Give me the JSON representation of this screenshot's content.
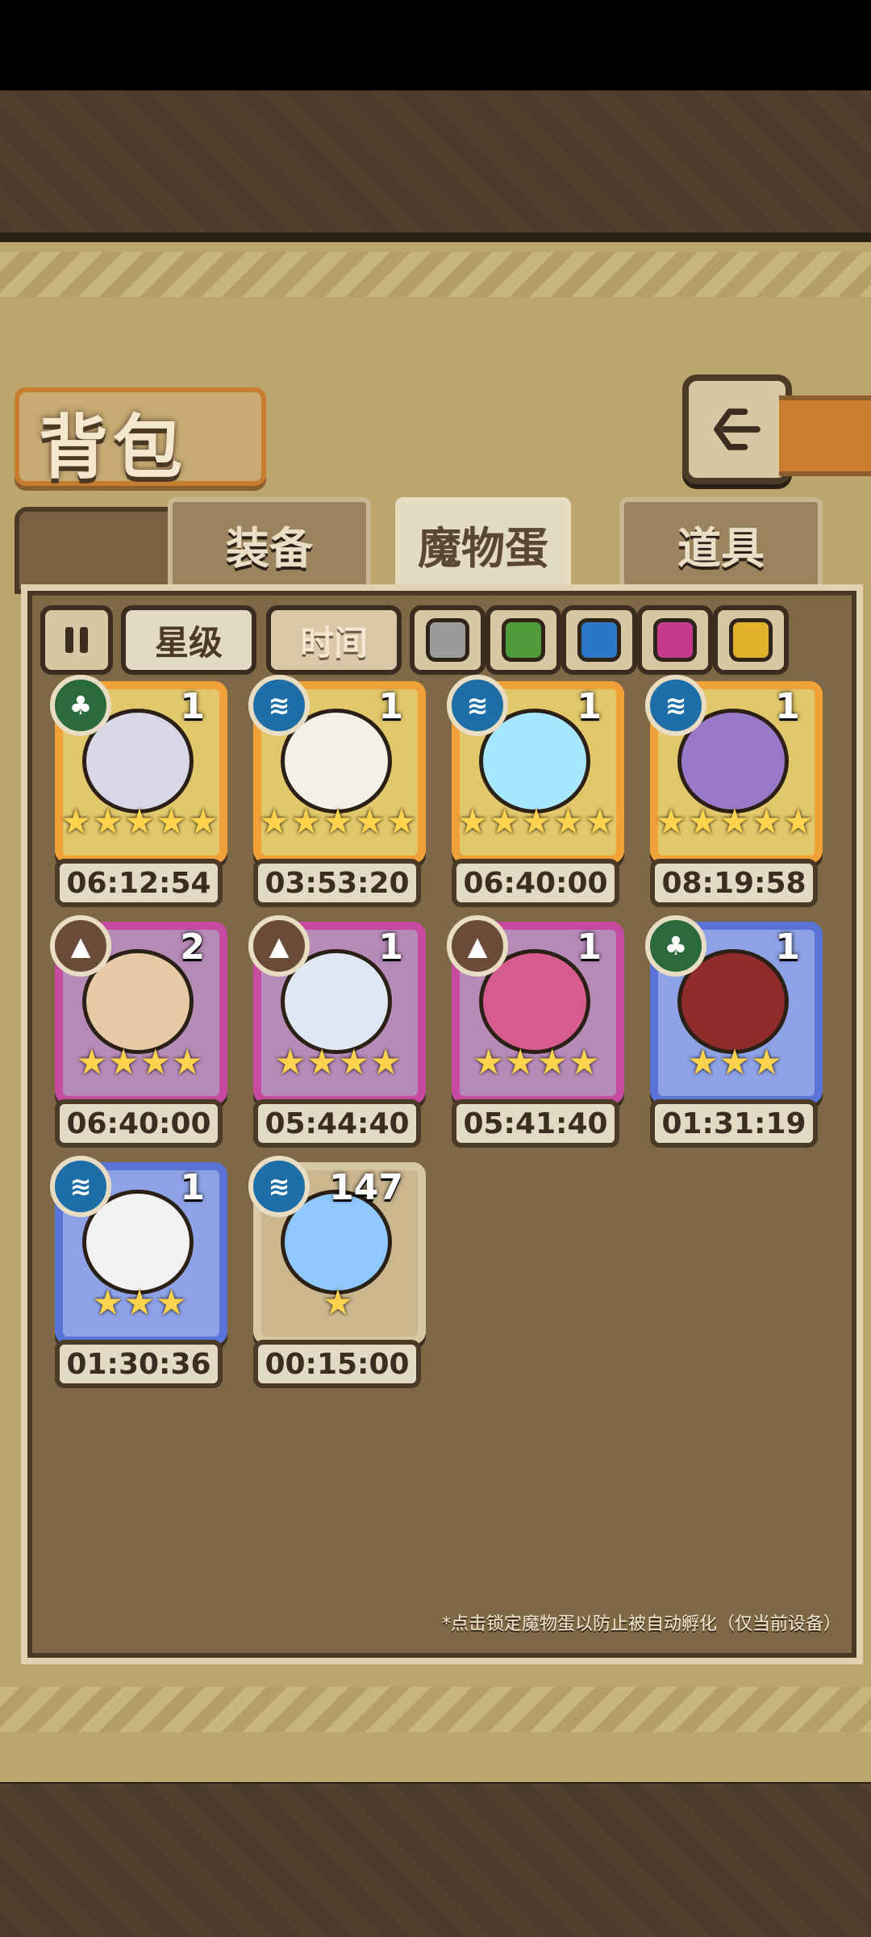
{
  "page": {
    "title": "背包",
    "tabs": [
      {
        "label": "装备"
      },
      {
        "label": "魔物蛋"
      },
      {
        "label": "道具"
      }
    ],
    "filters": {
      "toggle_icon": "pause-icon",
      "sort_star_label": "星级",
      "sort_time_label": "时间",
      "color_swatches": [
        "#9b9b9b",
        "#4f9a3a",
        "#2b77c6",
        "#c43a8d",
        "#e1b12c"
      ]
    },
    "footer_note": "*点击锁定魔物蛋以防止被自动孵化（仅当前设备）"
  },
  "eggs": [
    {
      "attr": "green",
      "attr_icon": "leaf-icon",
      "count": "1",
      "stars": "★★★★★",
      "time": "06:12:54",
      "rarity": "gold",
      "egg_color": "#d7d7e8"
    },
    {
      "attr": "blue",
      "attr_icon": "wave-icon",
      "count": "1",
      "stars": "★★★★★",
      "time": "03:53:20",
      "rarity": "gold",
      "egg_color": "#f3f0e6"
    },
    {
      "attr": "blue",
      "attr_icon": "wave-icon",
      "count": "1",
      "stars": "★★★★★",
      "time": "06:40:00",
      "rarity": "gold",
      "egg_color": "#a7e6ff"
    },
    {
      "attr": "blue",
      "attr_icon": "wave-icon",
      "count": "1",
      "stars": "★★★★★",
      "time": "08:19:58",
      "rarity": "gold",
      "egg_color": "#9a7ac8"
    },
    {
      "attr": "brown",
      "attr_icon": "mountain-icon",
      "count": "2",
      "stars": "★★★★",
      "time": "06:40:00",
      "rarity": "pink",
      "egg_color": "#e7c9a6"
    },
    {
      "attr": "brown",
      "attr_icon": "mountain-icon",
      "count": "1",
      "stars": "★★★★",
      "time": "05:44:40",
      "rarity": "pink",
      "egg_color": "#dfe7f2"
    },
    {
      "attr": "brown",
      "attr_icon": "mountain-icon",
      "count": "1",
      "stars": "★★★★",
      "time": "05:41:40",
      "rarity": "pink",
      "egg_color": "#d65c8d"
    },
    {
      "attr": "green",
      "attr_icon": "leaf-icon",
      "count": "1",
      "stars": "★★★",
      "time": "01:31:19",
      "rarity": "blue",
      "egg_color": "#8f2b2b"
    },
    {
      "attr": "blue",
      "attr_icon": "wave-icon",
      "count": "1",
      "stars": "★★★",
      "time": "01:30:36",
      "rarity": "blue",
      "egg_color": "#f2f2f2"
    },
    {
      "attr": "blue",
      "attr_icon": "wave-icon",
      "count": "147",
      "stars": "★",
      "time": "00:15:00",
      "rarity": "tan",
      "egg_color": "#8fc7ff"
    }
  ]
}
